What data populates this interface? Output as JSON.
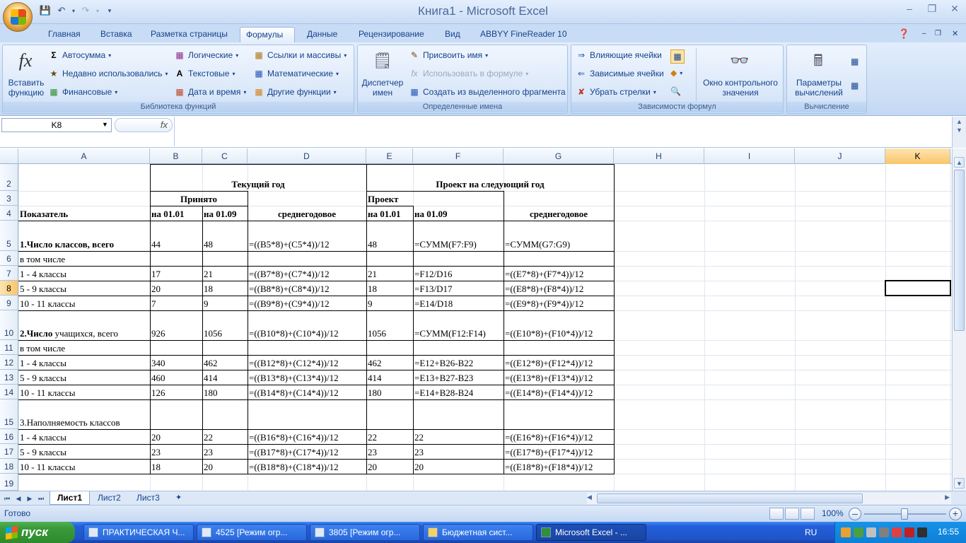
{
  "window": {
    "title": "Книга1 - Microsoft Excel"
  },
  "ribbon": {
    "tabs": [
      "Главная",
      "Вставка",
      "Разметка страницы",
      "Формулы",
      "Данные",
      "Рецензирование",
      "Вид",
      "ABBYY FineReader 10"
    ],
    "active_tab": "Формулы",
    "groups": {
      "function_library": {
        "label": "Библиотека функций",
        "insert_function": "Вставить функцию",
        "insert_function_line1": "Вставить",
        "insert_function_line2": "функцию",
        "autosum": "Автосумма",
        "recent": "Недавно использовались",
        "financial": "Финансовые",
        "logical": "Логические",
        "text": "Текстовые",
        "datetime": "Дата и время",
        "lookup": "Ссылки и массивы",
        "math": "Математические",
        "other": "Другие функции"
      },
      "defined_names": {
        "label": "Определенные имена",
        "name_manager_line1": "Диспетчер",
        "name_manager_line2": "имен",
        "define_name": "Присвоить имя",
        "use_in_formula": "Использовать в формуле",
        "create_from_selection": "Создать из выделенного фрагмента"
      },
      "formula_auditing": {
        "label": "Зависимости формул",
        "trace_precedents": "Влияющие ячейки",
        "trace_dependents": "Зависимые ячейки",
        "remove_arrows": "Убрать стрелки",
        "watch_window_line1": "Окно контрольного",
        "watch_window_line2": "значения"
      },
      "calculation": {
        "label": "Вычисление",
        "options_line1": "Параметры",
        "options_line2": "вычислений"
      }
    }
  },
  "formula_bar": {
    "name_box": "K8",
    "fx": "fx",
    "formula": ""
  },
  "columns": [
    "A",
    "B",
    "C",
    "D",
    "E",
    "F",
    "G",
    "H",
    "I",
    "J",
    "K"
  ],
  "rows": [
    "2",
    "3",
    "4",
    "5",
    "6",
    "7",
    "8",
    "9",
    "10",
    "11",
    "12",
    "13",
    "14",
    "15",
    "16",
    "17",
    "18",
    "19"
  ],
  "cells": {
    "B2": "Текущий год",
    "E2": "Проект на следующий год",
    "B3": "Принято",
    "E3": "Проект",
    "A4": "Показатель",
    "B4": "на 01.01",
    "C4": "на 01.09",
    "D4": "среднегодовое",
    "E4": "на 01.01",
    "F4": "на 01.09",
    "G4": "среднегодовое",
    "A5": "1.Число классов, всего",
    "B5": "44",
    "C5": "48",
    "D5": "=((B5*8)+(C5*4))/12",
    "E5": "48",
    "F5": "=СУММ(F7:F9)",
    "G5": "=СУММ(G7:G9)",
    "A6": "в том числе",
    "A7": "1 - 4 классы",
    "B7": "17",
    "C7": "21",
    "D7": "=((B7*8)+(C7*4))/12",
    "E7": "21",
    "F7": "=F12/D16",
    "G7": "=((E7*8)+(F7*4))/12",
    "A8": "5 - 9 классы",
    "B8": "20",
    "C8": "18",
    "D8": "=((B8*8)+(C8*4))/12",
    "E8": "18",
    "F8": "=F13/D17",
    "G8": "=((E8*8)+(F8*4))/12",
    "A9": "10 - 11 классы",
    "B9": "7",
    "C9": "9",
    "D9": "=((B9*8)+(C9*4))/12",
    "E9": "9",
    "F9": "=E14/D18",
    "G9": "=((E9*8)+(F9*4))/12",
    "A10_bold": "2.Число",
    "A10_rest": " учащихся, всего",
    "B10": "926",
    "C10": "1056",
    "D10": "=((B10*8)+(C10*4))/12",
    "E10": "1056",
    "F10": "=СУММ(F12:F14)",
    "G10": "=((E10*8)+(F10*4))/12",
    "A11": "в том числе",
    "A12": "1 - 4 классы",
    "B12": "340",
    "C12": "462",
    "D12": "=((B12*8)+(C12*4))/12",
    "E12": "462",
    "F12": "=E12+B26-B22",
    "G12": "=((E12*8)+(F12*4))/12",
    "A13": "5 - 9 классы",
    "B13": "460",
    "C13": "414",
    "D13": "=((B13*8)+(C13*4))/12",
    "E13": "414",
    "F13": "=E13+B27-B23",
    "G13": "=((E13*8)+(F13*4))/12",
    "A14": "10 - 11 классы",
    "B14": "126",
    "C14": "180",
    "D14": "=((B14*8)+(C14*4))/12",
    "E14": "180",
    "F14": "=E14+B28-B24",
    "G14": "=((E14*8)+(F14*4))/12",
    "A15": "3.Наполняемость классов",
    "A16": "1 - 4 классы",
    "B16": "20",
    "C16": "22",
    "D16": "=((B16*8)+(C16*4))/12",
    "E16": "22",
    "F16": "22",
    "G16": "=((E16*8)+(F16*4))/12",
    "A17": "5 - 9 классы",
    "B17": "23",
    "C17": "23",
    "D17": "=((B17*8)+(C17*4))/12",
    "E17": "23",
    "F17": "23",
    "G17": "=((E17*8)+(F17*4))/12",
    "A18": "10 - 11 классы",
    "B18": "18",
    "C18": "20",
    "D18": "=((B18*8)+(C18*4))/12",
    "E18": "20",
    "F18": "20",
    "G18": "=((E18*8)+(F18*4))/12"
  },
  "sheets": [
    "Лист1",
    "Лист2",
    "Лист3"
  ],
  "active_sheet": "Лист1",
  "status": {
    "ready": "Готово",
    "zoom": "100%"
  },
  "taskbar": {
    "start": "пуск",
    "items": [
      "ПРАКТИЧЕСКАЯ Ч...",
      "4525 [Режим огр...",
      "3805 [Режим огр...",
      "Бюджетная сист...",
      "Microsoft Excel - ..."
    ],
    "lang": "RU",
    "clock": "16:55"
  }
}
